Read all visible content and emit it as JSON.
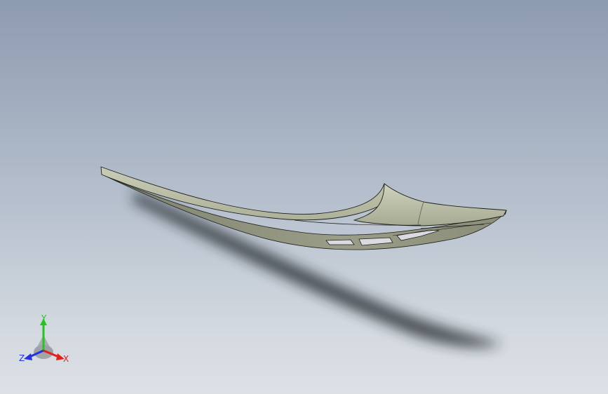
{
  "viewport": {
    "background_top": "#8e9bb0",
    "background_bottom": "#dde1e6",
    "model": {
      "description_icon": "curved-blade-part",
      "surface_color": "#b9bca5",
      "shade_color": "#8f927c",
      "edge_color": "#1e1f1a"
    }
  },
  "triad": {
    "x_label": "X",
    "y_label": "Y",
    "z_label": "Z",
    "x_color": "#e0221b",
    "y_color": "#25c51f",
    "z_color": "#2233e0"
  }
}
